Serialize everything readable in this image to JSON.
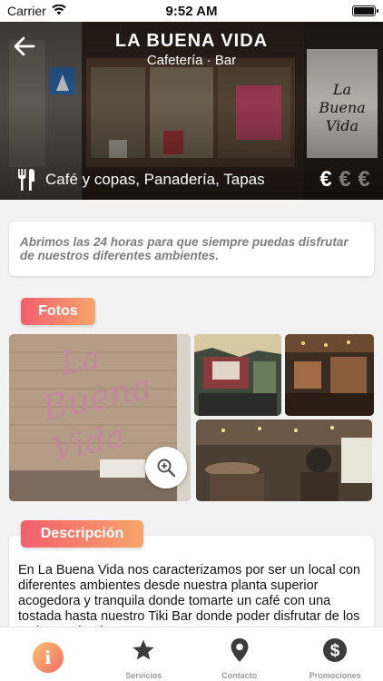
{
  "status_bar": {
    "carrier": "Carrier",
    "time": "9:52 AM"
  },
  "header": {
    "title": "LA BUENA VIDA",
    "subtitle": "Cafetería · Bar",
    "categories": "Café y copas, Panadería, Tapas",
    "price_symbols": [
      "€",
      "€",
      "€"
    ],
    "price_level": 1
  },
  "intro": {
    "text": "Abrimos las 24 horas para que siempre puedas disfrutar de nuestros diferentes ambientes."
  },
  "photos": {
    "label": "Fotos"
  },
  "description": {
    "label": "Descripción",
    "text": "En La Buena Vida nos caracterizamos por ser un local con diferentes ambientes desde nuestra planta superior acogedora y tranquila donde tomarte un café con una tostada hasta nuestro Tiki Bar donde poder disfrutar de los mejores cócteles."
  },
  "tabbar": {
    "servicios": "Servicios",
    "contacto": "Contacto",
    "promociones": "Promociones",
    "info_glyph": "i"
  },
  "colors": {
    "accent_start": "#f25f6d",
    "accent_end": "#f6a56c"
  }
}
